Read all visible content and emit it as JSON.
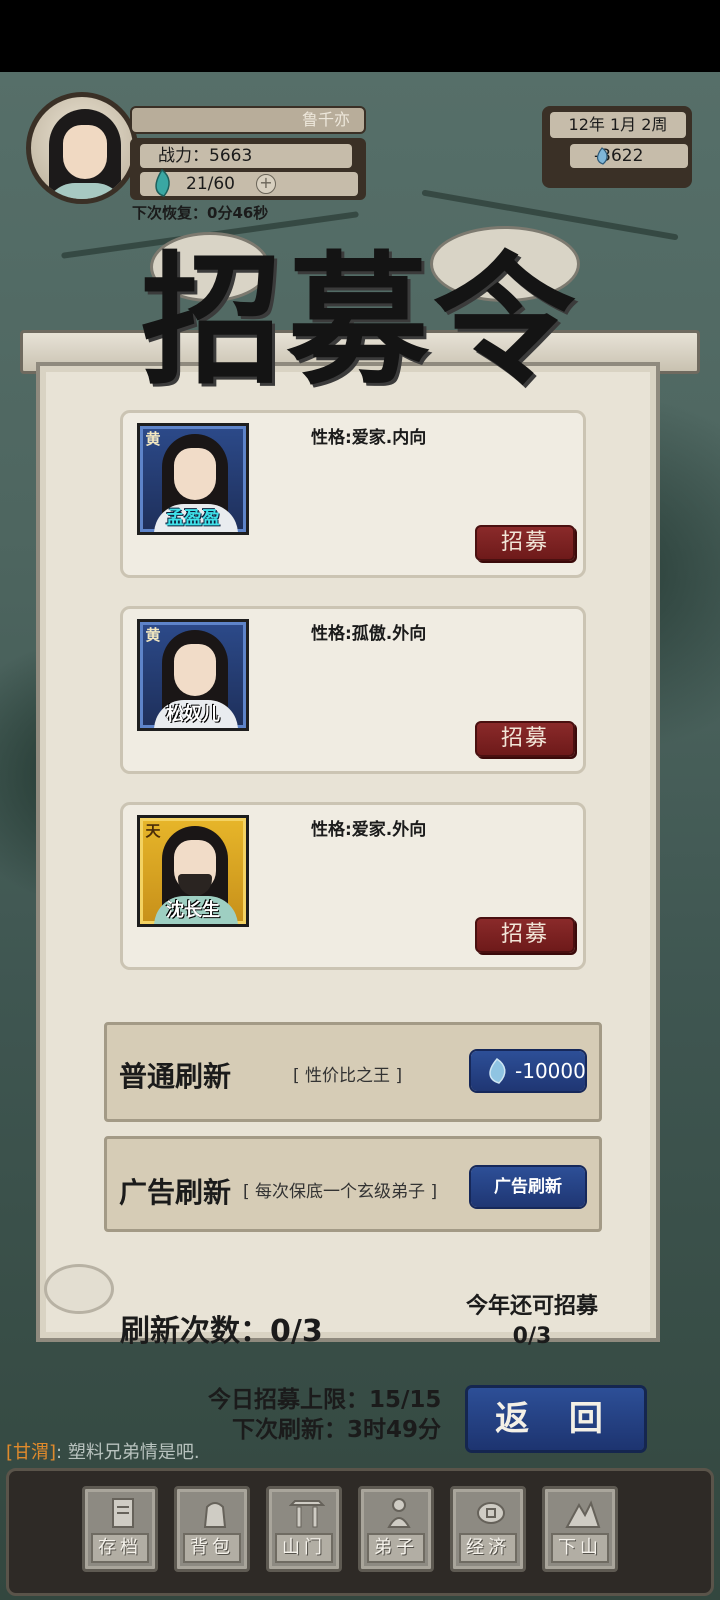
{
  "player": {
    "name": "鲁千亦",
    "power": "战力：5663",
    "stamina": "21/60",
    "recover": "下次恢复：0分46秒"
  },
  "calendar": {
    "date": "12年  1月  2周",
    "money": "-3622"
  },
  "title": "招募令",
  "candidates": [
    {
      "name": "孟盈盈",
      "grade": "黄",
      "trait": "性格:爱家.内向",
      "button": "招募"
    },
    {
      "name": "松奴儿",
      "grade": "黄",
      "trait": "性格:孤傲.外向",
      "button": "招募"
    },
    {
      "name": "沈长生",
      "grade": "天",
      "trait": "性格:爱家.外向",
      "button": "招募"
    }
  ],
  "normal_refresh": {
    "label": "普通刷新",
    "note": "[ 性价比之王 ]",
    "cost": "-10000"
  },
  "ad_refresh": {
    "label": "广告刷新",
    "note": "[ 每次保底一个玄级弟子 ]",
    "button": "广告刷新"
  },
  "refresh_count": "刷新次数：0/3",
  "year_remaining": "今年还可招募0/3",
  "daily_limit": "今日招募上限：15/15",
  "next_refresh": "下次刷新：3时49分",
  "back_button": "返 回",
  "chat": {
    "tag": "[甘渭]",
    "message": ": 塑料兄弟情是吧."
  },
  "nav": [
    "存档",
    "背包",
    "山门",
    "弟子",
    "经济",
    "下山"
  ],
  "colors": {
    "recruit_red": "#7a2020",
    "action_blue": "#25438a",
    "panel_bg": "#e8e3d6"
  }
}
